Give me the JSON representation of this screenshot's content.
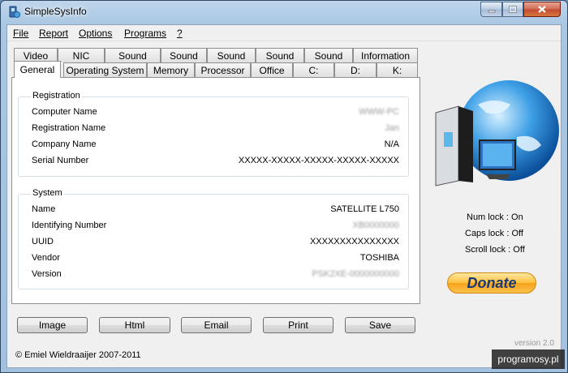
{
  "window": {
    "title": "SimpleSysInfo"
  },
  "menu": [
    "File",
    "Report",
    "Options",
    "Programs",
    "?"
  ],
  "tabs_row1": [
    "Video",
    "NIC",
    "Sound",
    "Sound",
    "Sound",
    "Sound",
    "Sound",
    "Information"
  ],
  "tabs_row2": [
    "General",
    "Operating System",
    "Memory",
    "Processor",
    "Office",
    "C:",
    "D:",
    "K:"
  ],
  "registration": {
    "title": "Registration",
    "rows": [
      {
        "label": "Computer Name",
        "value": "WWW-PC"
      },
      {
        "label": "Registration Name",
        "value": "Jan"
      },
      {
        "label": "Company Name",
        "value": "N/A"
      },
      {
        "label": "Serial Number",
        "value": "XXXXX-XXXXX-XXXXX-XXXXX-XXXXX"
      }
    ]
  },
  "system": {
    "title": "System",
    "rows": [
      {
        "label": "Name",
        "value": "SATELLITE L750"
      },
      {
        "label": "Identifying Number",
        "value": "XB0000000"
      },
      {
        "label": "UUID",
        "value": "XXXXXXXXXXXXXXX"
      },
      {
        "label": "Vendor",
        "value": "TOSHIBA"
      },
      {
        "label": "Version",
        "value": "PSK2XE-0000000000"
      }
    ]
  },
  "locks": [
    "Num lock : On",
    "Caps lock : Off",
    "Scroll lock : Off"
  ],
  "donate": "Donate",
  "buttons": [
    "Image",
    "Html",
    "Email",
    "Print",
    "Save"
  ],
  "copyright": "© Emiel Wieldraaijer 2007-2011",
  "watermark": "programosy.pl",
  "version": "version 2.0"
}
